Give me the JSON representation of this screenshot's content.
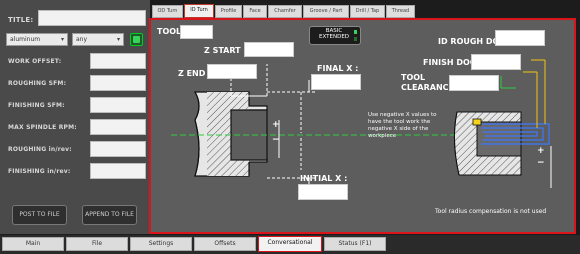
{
  "left_panel": {
    "title_label": "TITLE:",
    "material_value": "aluminum",
    "units_value": "any",
    "fields": [
      {
        "label": "WORK OFFSET:"
      },
      {
        "label": "ROUGHING SFM:"
      },
      {
        "label": "FINISHING SFM:"
      },
      {
        "label": "MAX SPINDLE RPM:"
      },
      {
        "label": "ROUGHING in/rev:"
      },
      {
        "label": "FINISHING in/rev:"
      }
    ],
    "post_button": "POST TO FILE",
    "append_button": "APPEND TO FILE"
  },
  "tabs": [
    "OD Turn",
    "ID Turn",
    "Profile",
    "Face",
    "Chamfer",
    "Groove / Part",
    "Drill / Tap",
    "Thread"
  ],
  "active_tab_index": 1,
  "form": {
    "tool_label": "TOOL :",
    "basic_extended": [
      "BASIC",
      "EXTENDED"
    ],
    "z_start_label": "Z START :",
    "z_end_label": "Z END :",
    "final_x_label": "FINAL X :",
    "initial_x_label": "INITIAL X :",
    "id_rough_doc_label": "ID ROUGH DOC :",
    "finish_doc_label": "FINISH DOC :",
    "tool_clearance_label": [
      "TOOL",
      "CLEARANCE :"
    ],
    "note": "Use negative X values to have the tool work the negative X side of the workpiece",
    "footer_note": "Tool radius compensation is not used",
    "plus": "+",
    "minus": "−"
  },
  "bottom_tabs": [
    "Main",
    "File",
    "Settings",
    "Offsets",
    "Conversational",
    "Status (F1)"
  ],
  "active_bottom_tab_index": 4,
  "colors": {
    "accent_red": "#d9141a",
    "led_green": "#37d35a",
    "content_bg": "#5d5d5d"
  }
}
